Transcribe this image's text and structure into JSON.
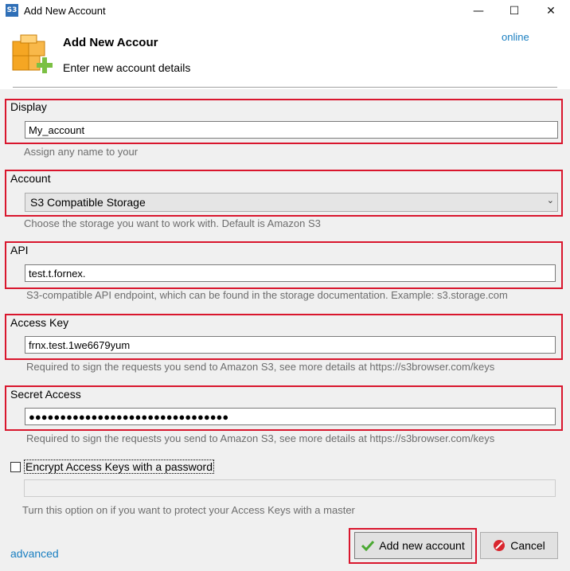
{
  "window": {
    "title": "Add New Account",
    "app_icon_text": "S3"
  },
  "controls": {
    "minimize": "—",
    "maximize": "☐",
    "close": "✕"
  },
  "header": {
    "title": "Add New Accour",
    "subtitle": "Enter new account details",
    "online_link": "online"
  },
  "fields": {
    "display": {
      "label": "Display",
      "value": "My_account",
      "help": "Assign any name to your"
    },
    "account_type": {
      "label": "Account",
      "selected": "S3 Compatible Storage",
      "help": "Choose the storage you want to work with. Default is Amazon S3"
    },
    "api": {
      "label": "API",
      "value": "test.t.fornex.",
      "help": "S3-compatible API endpoint, which can be found in the storage documentation. Example: s3.storage.com"
    },
    "access_key": {
      "label": "Access Key",
      "value": "frnx.test.1we6679yum",
      "help": "Required to sign the requests you send to Amazon S3, see more details at https://s3browser.com/keys"
    },
    "secret_access": {
      "label": "Secret Access",
      "value": "●●●●●●●●●●●●●●●●●●●●●●●●●●●●●●●●",
      "help": "Required to sign the requests you send to Amazon S3, see more details at https://s3browser.com/keys"
    }
  },
  "encrypt": {
    "label": "Encrypt Access Keys with a password",
    "checked": false,
    "help": "Turn this option on if you want to protect your Access Keys with a master"
  },
  "footer": {
    "advanced_link": "advanced",
    "add_button": "Add new account",
    "cancel_button": "Cancel"
  },
  "colors": {
    "highlight": "#d9162d",
    "link": "#1a7fc1",
    "logo_orange": "#f5a623",
    "add_green": "#7bc043"
  }
}
